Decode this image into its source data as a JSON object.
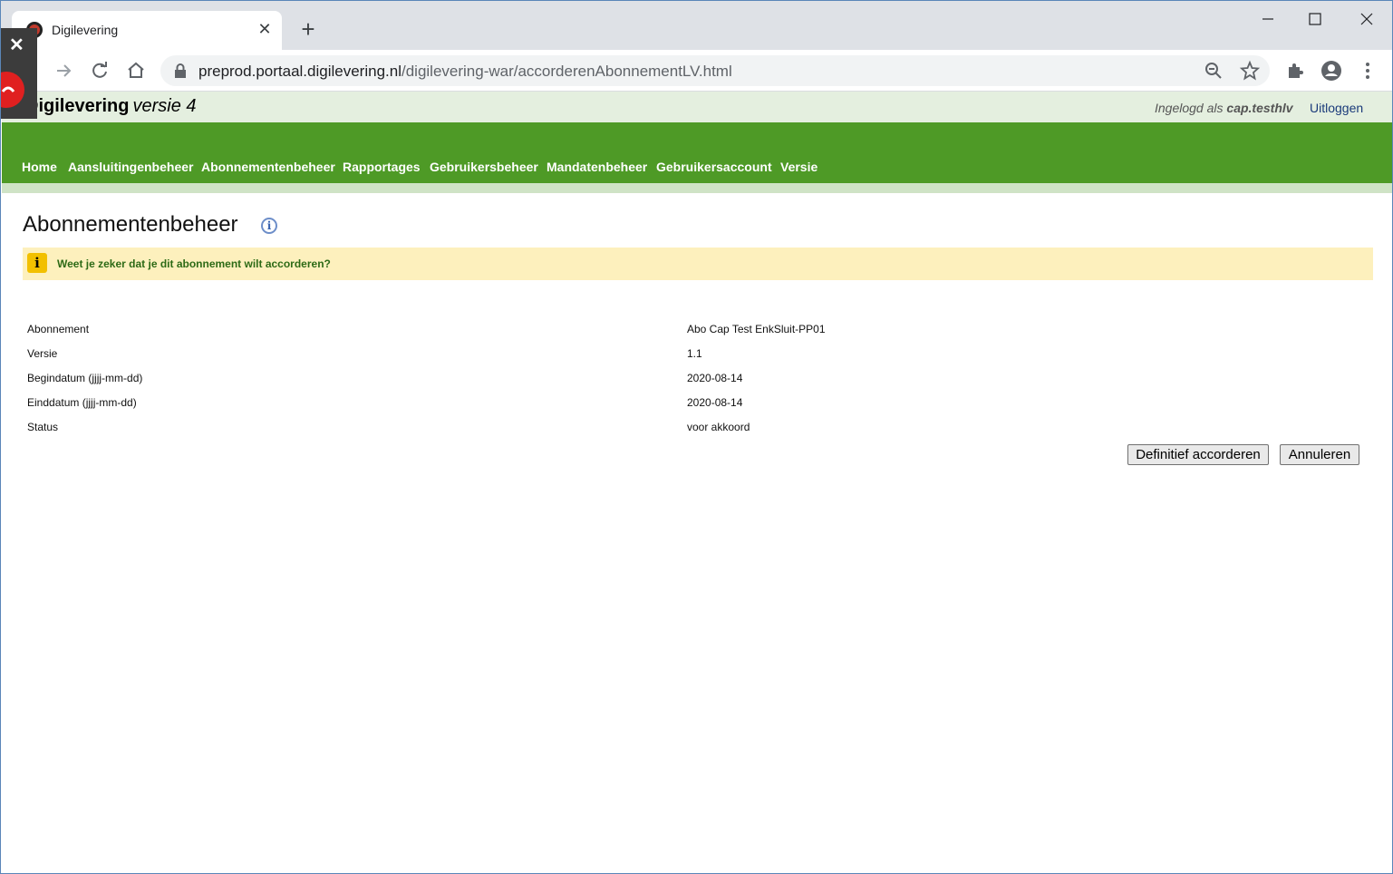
{
  "browser": {
    "tab_title": "Digilevering",
    "new_tab": "+",
    "url_host": "preprod.portaal.digilevering.nl",
    "url_path": "/digilevering-war/accorderenAbonnementLV.html"
  },
  "header": {
    "brand_first": "D",
    "brand_rest": "igilevering",
    "brand_version": "versie 4",
    "logged_in_prefix": "Ingelogd als",
    "logged_in_user": "cap.testhlv",
    "logout_label": "Uitloggen"
  },
  "nav": {
    "items": [
      "Home",
      "Aansluitingenbeheer",
      "Abonnementenbeheer",
      "Rapportages",
      "Gebruikersbeheer",
      "Mandatenbeheer",
      "Gebruikersaccount",
      "Versie"
    ]
  },
  "page": {
    "title": "Abonnementenbeheer",
    "info_glyph": "i",
    "notice": "Weet je zeker dat je dit abonnement wilt accorderen?",
    "notice_glyph": "i"
  },
  "details": [
    {
      "label": "Abonnement",
      "value": "Abo Cap Test EnkSluit-PP01"
    },
    {
      "label": "Versie",
      "value": "1.1"
    },
    {
      "label": "Begindatum (jjjj-mm-dd)",
      "value": "2020-08-14"
    },
    {
      "label": "Einddatum (jjjj-mm-dd)",
      "value": "2020-08-14"
    },
    {
      "label": "Status",
      "value": "voor akkoord"
    }
  ],
  "actions": {
    "confirm_label": "Definitief accorderen",
    "cancel_label": "Annuleren"
  },
  "colors": {
    "nav_green": "#4e9a26",
    "header_bg": "#e4efdf",
    "notice_bg": "#fdf0bd",
    "notice_text": "#2d6a16"
  }
}
